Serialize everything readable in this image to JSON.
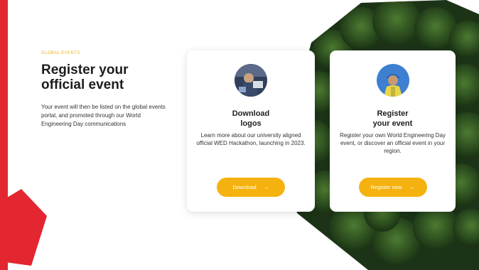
{
  "brand": {
    "accent": "#e3262f",
    "button_color": "#f5b20f",
    "eyebrow_color": "#f5b20f"
  },
  "intro": {
    "eyebrow": "GLOBAL EVENTS",
    "headline": "Register your official event",
    "body": "Your event will then be listed on the global events portal, and promoted through our World Engineering Day communications"
  },
  "cards": [
    {
      "title_line1": "Download",
      "title_line2": "logos",
      "description": "Learn more about our university aligned official WED Hackathon, launching in 2023.",
      "button_label": "Download",
      "button_icon": "arrow-right-icon"
    },
    {
      "title_line1": "Register",
      "title_line2": "your event",
      "description": "Register your own World Engineering Day event, or discover an official event in your region.",
      "button_label": "Register now",
      "button_icon": "arrow-right-icon"
    }
  ]
}
